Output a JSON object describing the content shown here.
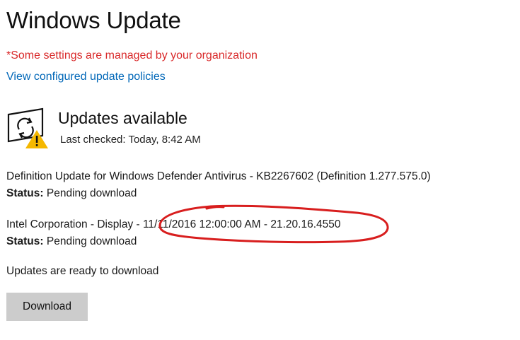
{
  "header": {
    "title": "Windows Update"
  },
  "notice": {
    "managed_text": "*Some settings are managed by your organization",
    "policies_link": "View configured update policies"
  },
  "status": {
    "icon": "update-warning-icon",
    "title": "Updates available",
    "last_checked": "Last checked: Today, 8:42 AM"
  },
  "updates": [
    {
      "name": "Definition Update for Windows Defender Antivirus - KB2267602 (Definition 1.277.575.0)",
      "status_label": "Status:",
      "status_value": "Pending download"
    },
    {
      "name": "Intel Corporation - Display - 11/11/2016 12:00:00 AM - 21.20.16.4550",
      "status_label": "Status:",
      "status_value": "Pending download"
    }
  ],
  "footer": {
    "ready_text": "Updates are ready to download",
    "download_label": "Download"
  },
  "colors": {
    "warning": "#d9292a",
    "link": "#0067b8",
    "button": "#cccccc",
    "annotation_marker": "#d81e1e",
    "warning_triangle": "#f5b800"
  }
}
